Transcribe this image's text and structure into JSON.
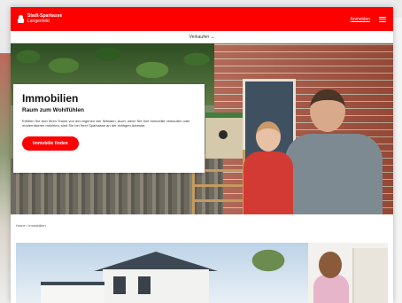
{
  "header": {
    "bank_name": "Stadt-Sparkasse",
    "bank_city": "Langenfeld",
    "login_label": "Anmelden",
    "brand_color": "#ff0000"
  },
  "subnav": {
    "label": "Verkaufen"
  },
  "hero": {
    "title": "Immobilien",
    "subtitle": "Raum zum Wohlfühlen",
    "text": "Erfüllen Sie sich Ihren Traum von den eigenen vier Wänden. Auch, wenn Sie Ihre Immobilie verkaufen oder modernisieren möchten, sind Sie bei Ihrer Sparkasse an der richtigen Adresse.",
    "cta_label": "Immobilie finden"
  },
  "breadcrumb": {
    "text": "Home › Immobilien"
  },
  "icons": {
    "logo": "sparkasse-logo",
    "menu": "hamburger-menu-icon",
    "subnav_chevron": "chevron-down-icon"
  }
}
